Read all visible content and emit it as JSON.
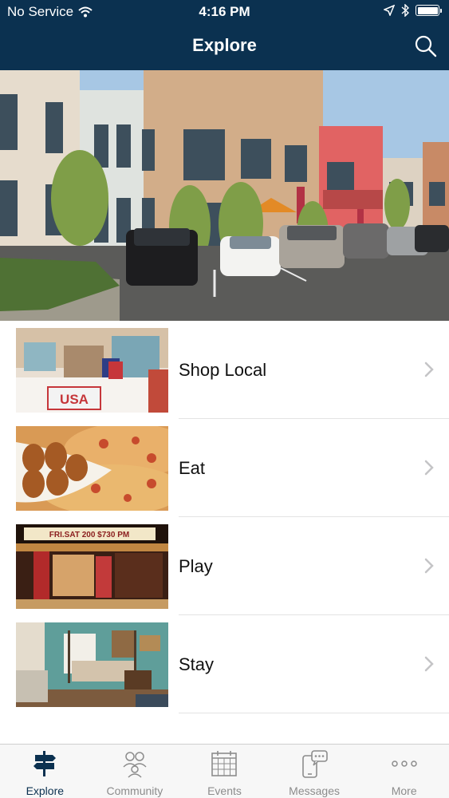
{
  "status_bar": {
    "carrier": "No Service",
    "time": "4:16 PM"
  },
  "nav": {
    "title": "Explore"
  },
  "list": [
    {
      "label": "Shop Local",
      "thumb_sign": "USA"
    },
    {
      "label": "Eat"
    },
    {
      "label": "Play",
      "thumb_sign": "FRI.SAT 200 $730 PM"
    },
    {
      "label": "Stay"
    }
  ],
  "tabs": [
    {
      "label": "Explore",
      "icon": "signpost-icon",
      "active": true
    },
    {
      "label": "Community",
      "icon": "people-icon"
    },
    {
      "label": "Events",
      "icon": "calendar-icon"
    },
    {
      "label": "Messages",
      "icon": "messages-icon"
    },
    {
      "label": "More",
      "icon": "more-dots-icon"
    }
  ],
  "colors": {
    "header": "#0b3150",
    "tab_active": "#0b3150",
    "tab_inactive": "#8c8c8c"
  }
}
